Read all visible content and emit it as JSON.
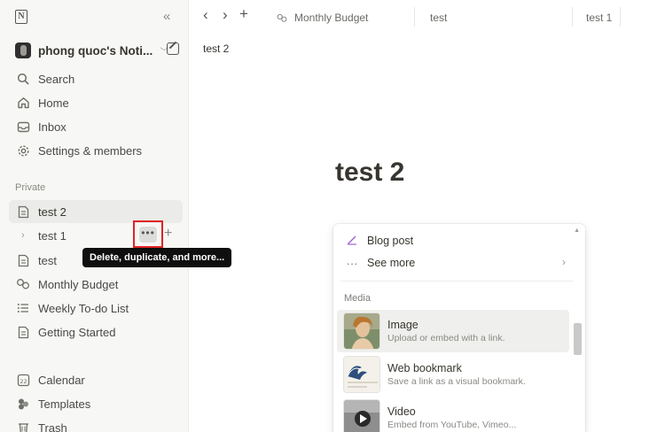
{
  "sidebar": {
    "workspace_name": "phong quoc's Noti...",
    "nav": [
      {
        "label": "Search",
        "icon": "search-icon"
      },
      {
        "label": "Home",
        "icon": "home-icon"
      },
      {
        "label": "Inbox",
        "icon": "inbox-icon"
      },
      {
        "label": "Settings & members",
        "icon": "gear-icon"
      }
    ],
    "section_private": "Private",
    "pages": [
      {
        "label": "test 2",
        "icon": "page-icon"
      },
      {
        "label": "test 1",
        "icon": "chevron-right-icon"
      },
      {
        "label": "test",
        "icon": "page-icon"
      },
      {
        "label": "Monthly Budget",
        "icon": "budget-icon"
      },
      {
        "label": "Weekly To-do List",
        "icon": "list-icon"
      },
      {
        "label": "Getting Started",
        "icon": "page-icon"
      }
    ],
    "bottom": [
      {
        "label": "Calendar",
        "icon": "calendar-icon",
        "icon_text": "22"
      },
      {
        "label": "Templates",
        "icon": "templates-icon"
      },
      {
        "label": "Trash",
        "icon": "trash-icon"
      }
    ],
    "more_button_glyph": "•••",
    "add_glyph": "+",
    "tooltip": "Delete, duplicate, and more..."
  },
  "topbar": {
    "tabs": [
      {
        "label": "Monthly Budget"
      },
      {
        "label": "test"
      },
      {
        "label": "test 1"
      }
    ]
  },
  "breadcrumb": "test 2",
  "page": {
    "title": "test 2"
  },
  "menu": {
    "items_top": [
      {
        "label": "Blog post",
        "icon": "pen-icon"
      },
      {
        "label": "See more",
        "icon": "ellipsis-icon"
      }
    ],
    "section_media": "Media",
    "media": [
      {
        "title": "Image",
        "subtitle": "Upload or embed with a link."
      },
      {
        "title": "Web bookmark",
        "subtitle": "Save a link as a visual bookmark."
      },
      {
        "title": "Video",
        "subtitle": "Embed from YouTube, Vimeo..."
      }
    ]
  },
  "colors": {
    "sidebar_bg": "#f7f7f5",
    "highlight_border": "#e02424",
    "tooltip_bg": "#0f0f0f",
    "text": "#37352f"
  }
}
